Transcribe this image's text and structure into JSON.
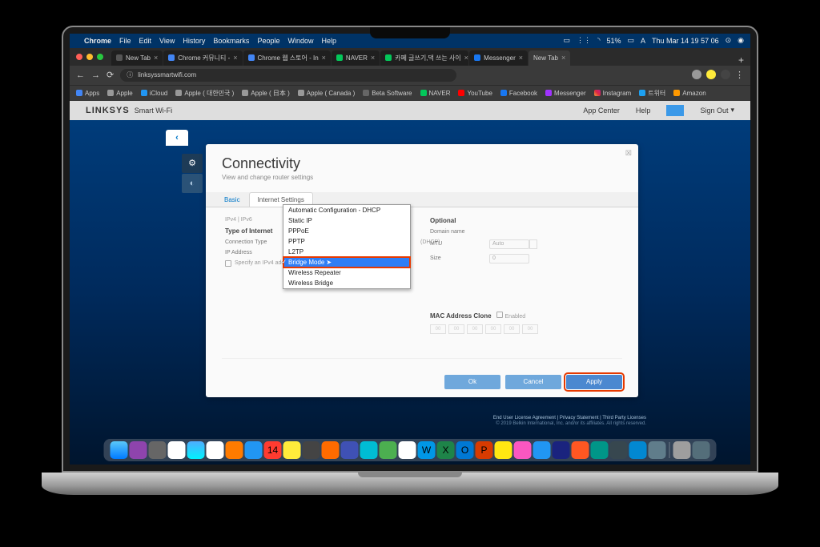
{
  "menubar": {
    "app": "Chrome",
    "items": [
      "File",
      "Edit",
      "View",
      "History",
      "Bookmarks",
      "People",
      "Window",
      "Help"
    ],
    "battery": "51%",
    "clock": "Thu Mar 14  19 57 06"
  },
  "browser": {
    "tabs": [
      {
        "label": "New Tab",
        "active": false
      },
      {
        "label": "Chrome 커뮤니티 - ",
        "active": false
      },
      {
        "label": "Chrome 웹 스토어 - In",
        "active": false
      },
      {
        "label": "NAVER",
        "active": false
      },
      {
        "label": "카페 글쓰기,댁 쓰는 사이",
        "active": false
      },
      {
        "label": "Messenger",
        "active": false
      },
      {
        "label": "New Tab",
        "active": true
      }
    ],
    "url": "linksyssmartwifi.com",
    "bookmarks": [
      "Apps",
      "Apple",
      "iCloud",
      "Apple ( 대한민국 )",
      "Apple ( 日本 )",
      "Apple ( Canada )",
      "Beta Software",
      "NAVER",
      "YouTube",
      "Facebook",
      "Messenger",
      "Instagram",
      "트위터",
      "Amazon"
    ]
  },
  "linksys": {
    "brand": "LINKSYS",
    "product": "Smart Wi-Fi",
    "nav": {
      "app_center": "App Center",
      "help": "Help",
      "sign_out": "Sign Out"
    }
  },
  "panel": {
    "title": "Connectivity",
    "subtitle": "View and change router settings",
    "tabs": {
      "basic": "Basic",
      "internet": "Internet Settings"
    },
    "ipver": "IPv4  |  IPv6",
    "type_label": "Type of Internet",
    "conn_label": "Connection Type",
    "dhcp_suffix": "(DHCP)",
    "ip_label": "IP Address",
    "specify": "Specify an IPv4 address",
    "dropdown": [
      "Automatic Configuration - DHCP",
      "Static IP",
      "PPPoE",
      "PPTP",
      "L2TP",
      "Bridge Mode",
      "Wireless Repeater",
      "Wireless Bridge"
    ],
    "optional": {
      "heading": "Optional",
      "domain": "Domain name",
      "mtu": "MTU",
      "mtu_val": "Auto",
      "size": "Size",
      "size_val": "0"
    },
    "mac": {
      "heading": "MAC Address Clone",
      "enabled": "Enabled",
      "parts": [
        "00",
        "00",
        "00",
        "00",
        "00",
        "00"
      ]
    },
    "buttons": {
      "ok": "Ok",
      "cancel": "Cancel",
      "apply": "Apply"
    }
  },
  "footer": {
    "links": "End User License Agreement  |  Privacy Statement  |  Third Party Licenses",
    "copyright": "© 2019 Belkin International, Inc. and/or its affiliates. All rights reserved."
  },
  "dock_count": 32
}
